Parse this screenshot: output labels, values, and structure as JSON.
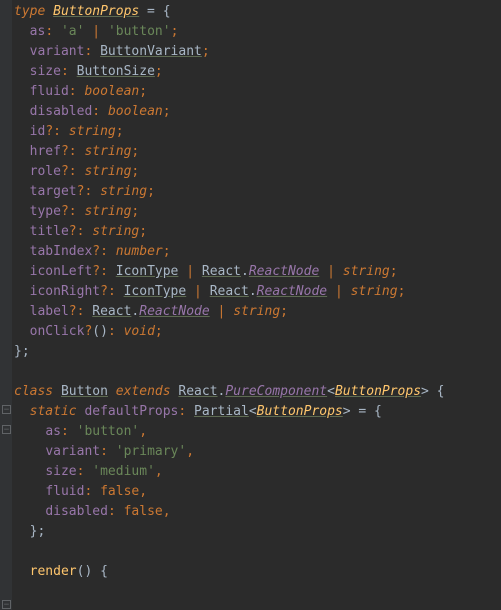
{
  "keywords": {
    "type": "type",
    "class": "class",
    "extends": "extends",
    "static": "static",
    "void": "void",
    "boolean": "boolean",
    "string": "string",
    "number": "number",
    "false": "false"
  },
  "typedef": {
    "name": "ButtonProps",
    "fields": [
      {
        "name": "as",
        "opt": false,
        "type_parts": [
          "'a'",
          " | ",
          "'button'"
        ],
        "kinds": [
          "str",
          "pipe",
          "str"
        ]
      },
      {
        "name": "variant",
        "opt": false,
        "type_parts": [
          "ButtonVariant"
        ],
        "kinds": [
          "type"
        ]
      },
      {
        "name": "size",
        "opt": false,
        "type_parts": [
          "ButtonSize"
        ],
        "kinds": [
          "type"
        ]
      },
      {
        "name": "fluid",
        "opt": false,
        "type_parts": [
          "boolean"
        ],
        "kinds": [
          "tprim"
        ]
      },
      {
        "name": "disabled",
        "opt": false,
        "type_parts": [
          "boolean"
        ],
        "kinds": [
          "tprim"
        ]
      },
      {
        "name": "id",
        "opt": true,
        "type_parts": [
          "string"
        ],
        "kinds": [
          "tprim"
        ]
      },
      {
        "name": "href",
        "opt": true,
        "type_parts": [
          "string"
        ],
        "kinds": [
          "tprim"
        ]
      },
      {
        "name": "role",
        "opt": true,
        "type_parts": [
          "string"
        ],
        "kinds": [
          "tprim"
        ]
      },
      {
        "name": "target",
        "opt": true,
        "type_parts": [
          "string"
        ],
        "kinds": [
          "tprim"
        ]
      },
      {
        "name": "type",
        "opt": true,
        "type_parts": [
          "string"
        ],
        "kinds": [
          "tprim"
        ]
      },
      {
        "name": "title",
        "opt": true,
        "type_parts": [
          "string"
        ],
        "kinds": [
          "tprim"
        ]
      },
      {
        "name": "tabIndex",
        "opt": true,
        "type_parts": [
          "number"
        ],
        "kinds": [
          "tprim"
        ]
      },
      {
        "name": "iconLeft",
        "opt": true,
        "type_parts": [
          "IconType",
          " | ",
          "React",
          ".",
          "ReactNode",
          " | ",
          "string"
        ],
        "kinds": [
          "type",
          "pipe",
          "react",
          "dot",
          "rnode",
          "pipe",
          "tprim"
        ]
      },
      {
        "name": "iconRight",
        "opt": true,
        "type_parts": [
          "IconType",
          " | ",
          "React",
          ".",
          "ReactNode",
          " | ",
          "string"
        ],
        "kinds": [
          "type",
          "pipe",
          "react",
          "dot",
          "rnode",
          "pipe",
          "tprim"
        ]
      },
      {
        "name": "label",
        "opt": true,
        "type_parts": [
          "React",
          ".",
          "ReactNode",
          " | ",
          "string"
        ],
        "kinds": [
          "react",
          "dot",
          "rnode",
          "pipe",
          "tprim"
        ]
      },
      {
        "name": "onClick",
        "opt": true,
        "call": "()",
        "type_parts": [
          "void"
        ],
        "kinds": [
          "tprim"
        ]
      }
    ]
  },
  "classdef": {
    "name": "Button",
    "extends_ns": "React",
    "extends_cls": "PureComponent",
    "generic": "ButtonProps",
    "defaults_label": "defaultProps",
    "partial": "Partial",
    "partial_generic": "ButtonProps",
    "defaults": [
      {
        "key": "as",
        "val": "'button'",
        "kind": "str"
      },
      {
        "key": "variant",
        "val": "'primary'",
        "kind": "str"
      },
      {
        "key": "size",
        "val": "'medium'",
        "kind": "str"
      },
      {
        "key": "fluid",
        "val": "false",
        "kind": "bool"
      },
      {
        "key": "disabled",
        "val": "false",
        "kind": "bool"
      }
    ],
    "render_name": "render"
  },
  "fold_positions": [
    405,
    425,
    600
  ]
}
